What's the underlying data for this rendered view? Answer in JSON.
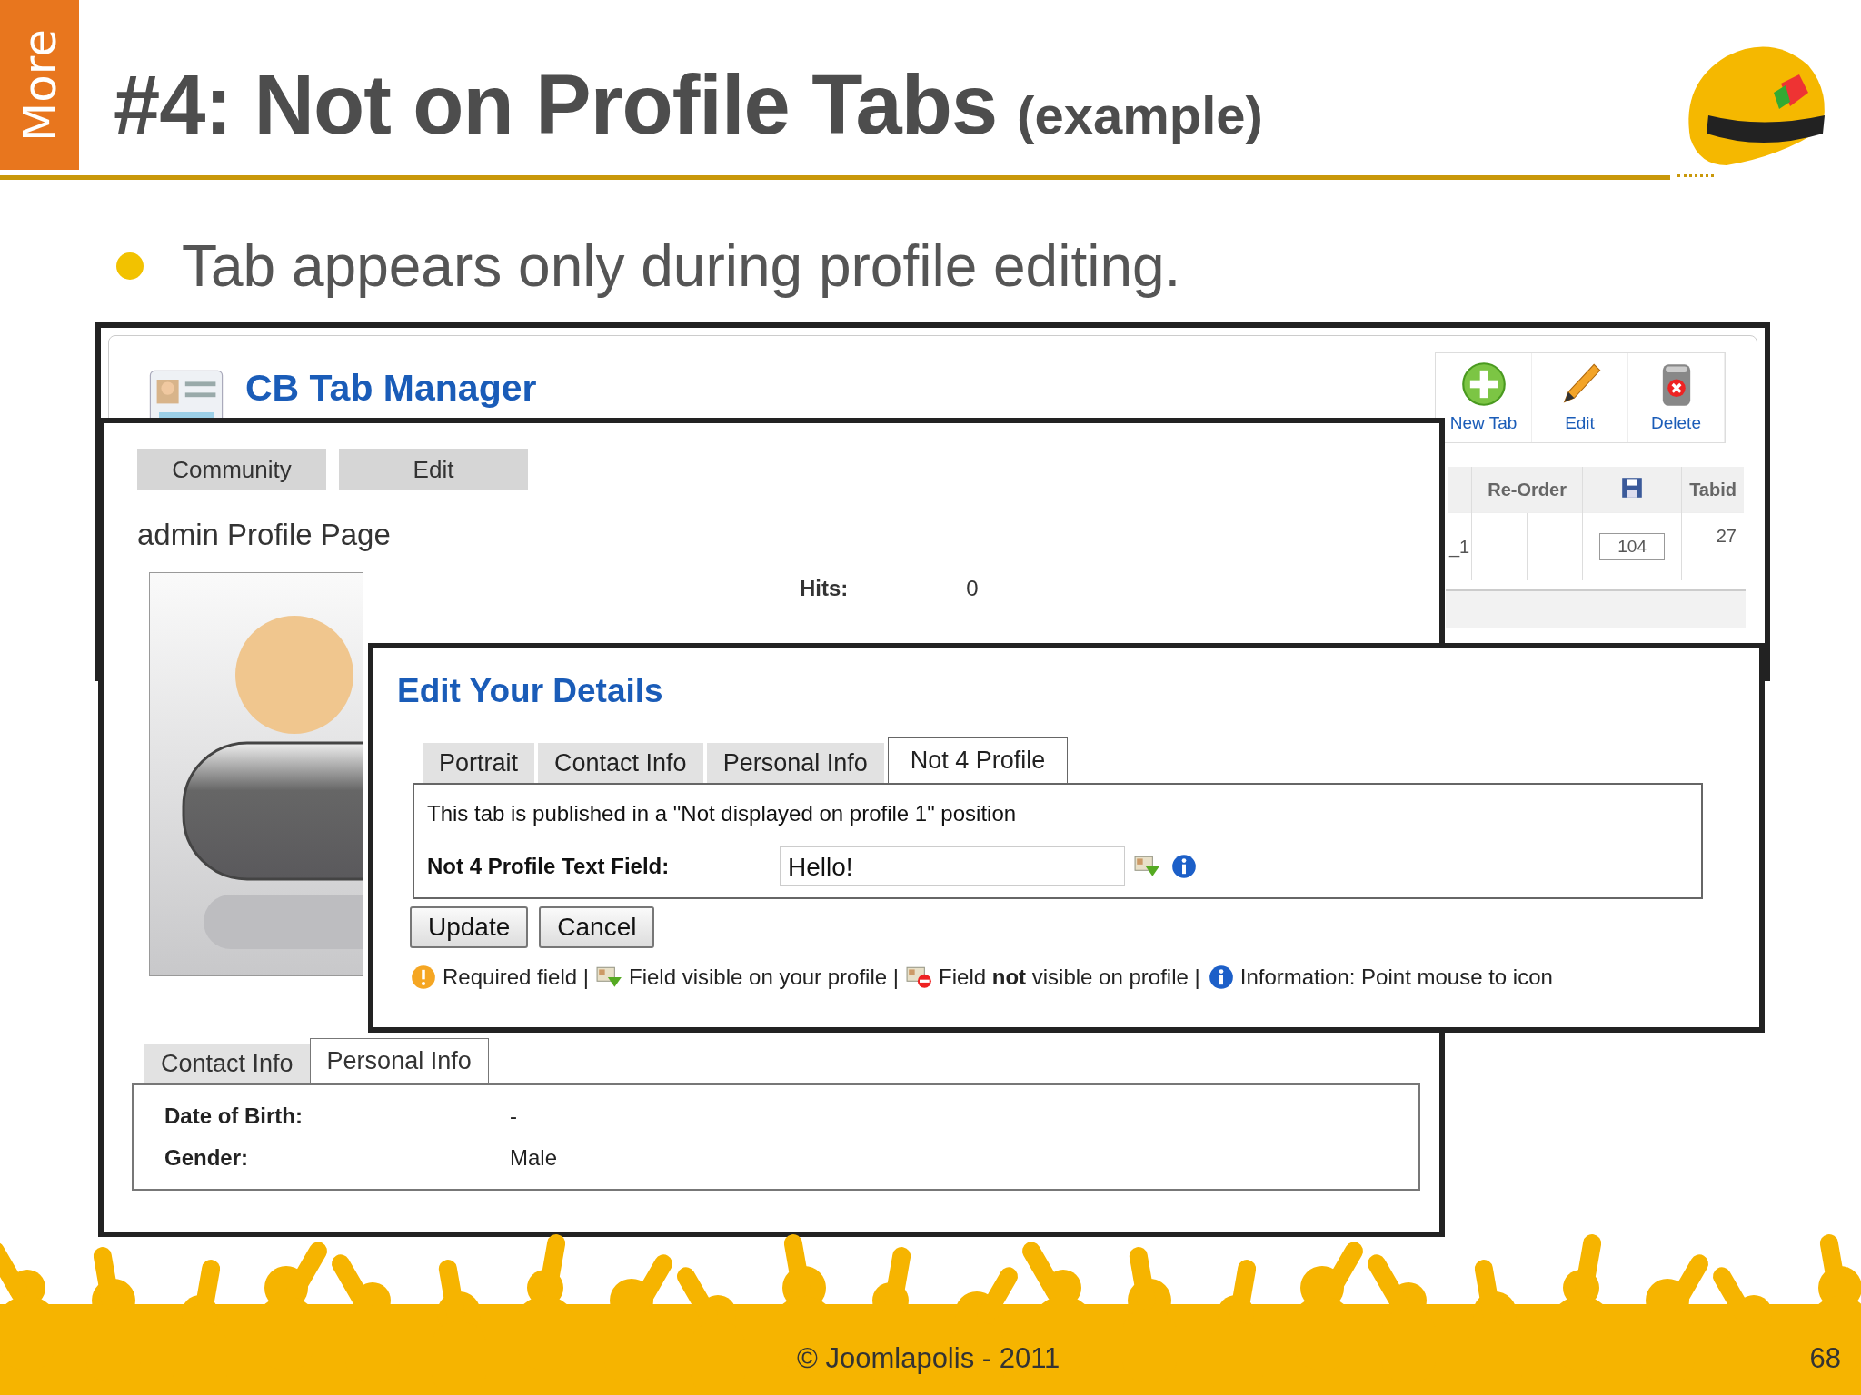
{
  "slide": {
    "section_tab": "More",
    "title": "#4: Not on Profile Tabs",
    "title_suffix": "(example)",
    "bullets": [
      "Tab appears only during profile editing."
    ],
    "footer": "© Joomlapolis - 2011",
    "page_number": "68"
  },
  "tab_manager": {
    "title": "CB Tab Manager",
    "toolbar": [
      {
        "label": "New Tab",
        "kind": "new"
      },
      {
        "label": "Edit",
        "kind": "edit"
      },
      {
        "label": "Delete",
        "kind": "delete"
      }
    ],
    "columns": [
      "Re-Order",
      "Tabid"
    ],
    "row": {
      "name": "_1",
      "ordering": "104",
      "tabid": "27"
    }
  },
  "profile": {
    "menu": [
      "Community",
      "Edit"
    ],
    "heading": "admin Profile Page",
    "hits_label": "Hits:",
    "hits_value": "0",
    "tabs": [
      {
        "label": "Contact Info",
        "selected": false
      },
      {
        "label": "Personal Info",
        "selected": true
      }
    ],
    "fields": [
      {
        "label": "Date of Birth:",
        "value": "-"
      },
      {
        "label": "Gender:",
        "value": "Male"
      }
    ]
  },
  "edit": {
    "title": "Edit Your Details",
    "tabs": [
      {
        "label": "Portrait",
        "selected": false
      },
      {
        "label": "Contact Info",
        "selected": false
      },
      {
        "label": "Personal Info",
        "selected": false
      },
      {
        "label": "Not 4 Profile",
        "selected": true
      }
    ],
    "notice": "This tab is published in a \"Not displayed on profile 1\" position",
    "field": {
      "label": "Not 4 Profile Text Field:",
      "value": "Hello!"
    },
    "buttons": [
      "Update",
      "Cancel"
    ],
    "legend": [
      {
        "kind": "required",
        "text": "Required field |"
      },
      {
        "kind": "visible",
        "text": "Field visible on your profile |"
      },
      {
        "kind": "hidden",
        "text": "Field **not** visible on profile |"
      },
      {
        "kind": "info",
        "text": "Information: Point mouse to icon"
      }
    ]
  }
}
